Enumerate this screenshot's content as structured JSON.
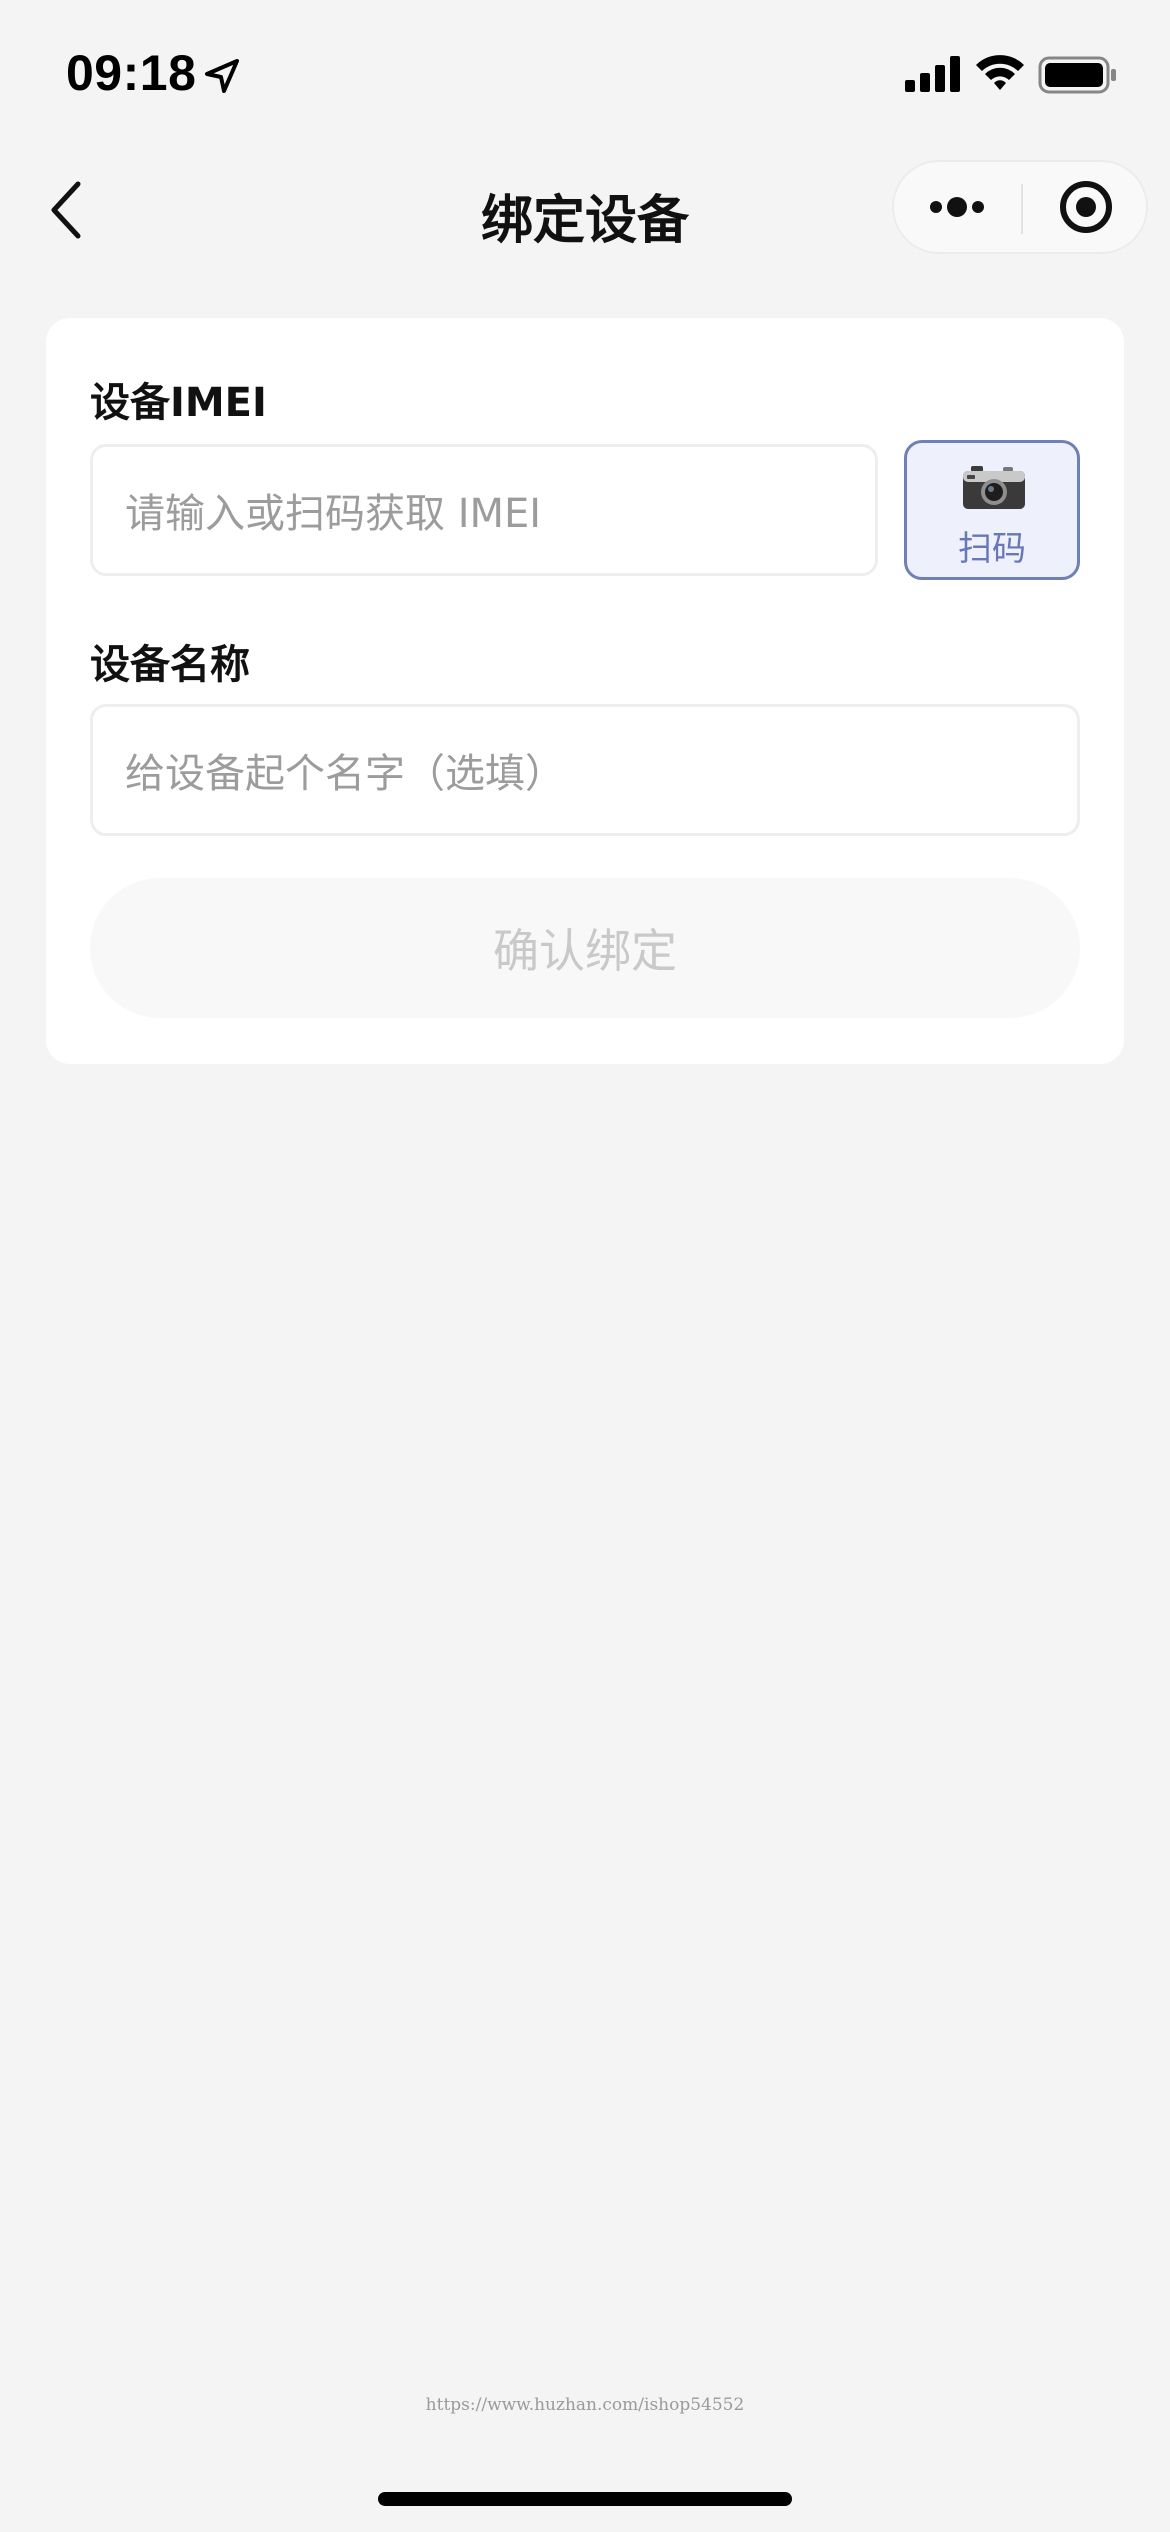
{
  "status_bar": {
    "time": "09:18",
    "icons": [
      "location-arrow-icon",
      "cellular-signal-icon",
      "wifi-icon",
      "battery-icon"
    ]
  },
  "nav": {
    "title": "绑定设备",
    "back_icon": "chevron-left-icon",
    "more_icon": "more-dots-icon",
    "close_icon": "target-close-icon"
  },
  "form": {
    "imei": {
      "label": "设备IMEI",
      "placeholder": "请输入或扫码获取 IMEI",
      "value": ""
    },
    "scan": {
      "icon": "camera-icon",
      "label": "扫码"
    },
    "name": {
      "label": "设备名称",
      "placeholder": "给设备起个名字（选填）",
      "value": ""
    },
    "confirm_label": "确认绑定"
  },
  "watermark": "https://www.huzhan.com/ishop54552",
  "colors": {
    "background": "#f4f4f4",
    "card": "#ffffff",
    "accent": "#6f7fb8",
    "scan_bg": "#eef0fb",
    "disabled_text": "#c9c9c9"
  }
}
